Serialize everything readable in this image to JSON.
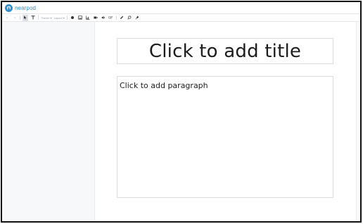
{
  "app": {
    "logo_text": "nearpod",
    "brand_color": "#2f8fcf"
  },
  "toolbar": {
    "undo_label": "↶",
    "redo_label": "↷",
    "theme_label": "Theme ▾",
    "layout_label": "Layout ▾",
    "icons": [
      "undo-icon",
      "redo-icon",
      "select-cursor-icon",
      "text-icon",
      "shape-circle-icon",
      "image-icon",
      "chart-icon",
      "video-icon",
      "audio-icon",
      "gif-icon",
      "pen-icon",
      "eraser-icon",
      "pin-icon"
    ]
  },
  "slide": {
    "title_placeholder": "Click to add title",
    "paragraph_placeholder": "Click to add paragraph"
  }
}
